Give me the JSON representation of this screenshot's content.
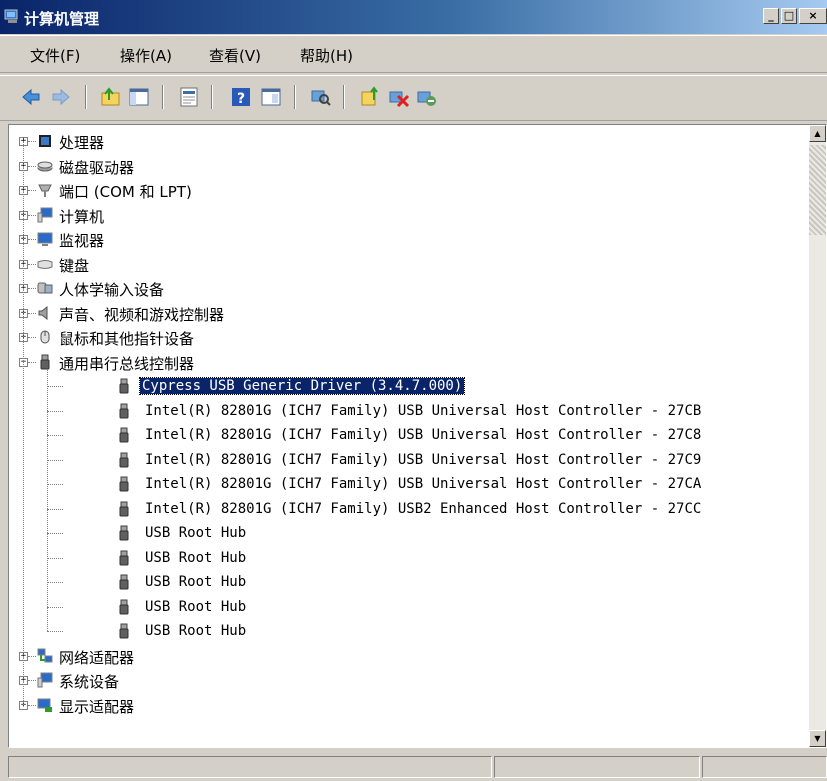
{
  "window": {
    "title": "计算机管理"
  },
  "window_buttons": {
    "minimize": "_",
    "maximize": "□",
    "close": "×"
  },
  "menu": [
    "文件(F)",
    "操作(A)",
    "查看(V)",
    "帮助(H)"
  ],
  "toolbar": [
    "back-icon",
    "forward-icon",
    "up-folder-icon",
    "show-hide-tree-icon",
    "export-icon",
    "help-icon",
    "properties-icon",
    "scan-hardware-icon",
    "update-driver-icon",
    "uninstall-icon",
    "disable-icon"
  ],
  "tree": {
    "categories_top": [
      {
        "label": "处理器",
        "icon": "cpu-icon"
      },
      {
        "label": "磁盘驱动器",
        "icon": "disk-drive-icon"
      },
      {
        "label": "端口 (COM 和 LPT)",
        "icon": "port-icon"
      },
      {
        "label": "计算机",
        "icon": "computer-icon"
      },
      {
        "label": "监视器",
        "icon": "monitor-icon"
      },
      {
        "label": "键盘",
        "icon": "keyboard-icon"
      },
      {
        "label": "人体学输入设备",
        "icon": "hid-icon"
      },
      {
        "label": "声音、视频和游戏控制器",
        "icon": "sound-icon"
      },
      {
        "label": "鼠标和其他指针设备",
        "icon": "mouse-icon"
      }
    ],
    "usb_category": {
      "label": "通用串行总线控制器",
      "icon": "usb-icon"
    },
    "usb_devices": [
      "Cypress USB Generic Driver (3.4.7.000)",
      "Intel(R) 82801G (ICH7 Family) USB Universal Host Controller - 27CB",
      "Intel(R) 82801G (ICH7 Family) USB Universal Host Controller - 27C8",
      "Intel(R) 82801G (ICH7 Family) USB Universal Host Controller - 27C9",
      "Intel(R) 82801G (ICH7 Family) USB Universal Host Controller - 27CA",
      "Intel(R) 82801G (ICH7 Family) USB2 Enhanced Host Controller - 27CC",
      "USB Root Hub",
      "USB Root Hub",
      "USB Root Hub",
      "USB Root Hub",
      "USB Root Hub"
    ],
    "categories_bottom": [
      {
        "label": "网络适配器",
        "icon": "network-adapter-icon"
      },
      {
        "label": "系统设备",
        "icon": "system-devices-icon"
      },
      {
        "label": "显示适配器",
        "icon": "display-adapter-icon"
      }
    ]
  },
  "colors": {
    "selection": "#0a246a",
    "titlebar": "#0a246a",
    "face": "#d4d0c8"
  }
}
